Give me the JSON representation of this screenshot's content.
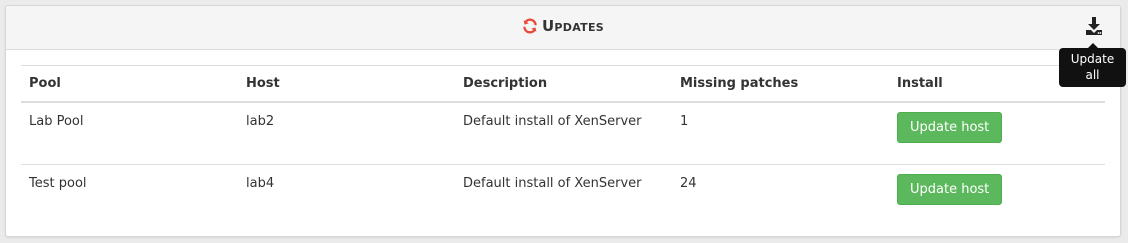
{
  "panel": {
    "title": "Updates",
    "title_icon": "refresh-icon",
    "update_all_icon": "download-icon",
    "update_all_tooltip": "Update all"
  },
  "table": {
    "columns": [
      "Pool",
      "Host",
      "Description",
      "Missing patches",
      "Install"
    ],
    "rows": [
      {
        "pool": "Lab Pool",
        "host": "lab2",
        "description": "Default install of XenServer",
        "missing_patches": "1",
        "install_label": "Update host"
      },
      {
        "pool": "Test pool",
        "host": "lab4",
        "description": "Default install of XenServer",
        "missing_patches": "24",
        "install_label": "Update host"
      }
    ]
  },
  "colors": {
    "accent_icon": "#e74c3c",
    "success_button": "#5cb85c",
    "tooltip_bg": "#111111"
  }
}
